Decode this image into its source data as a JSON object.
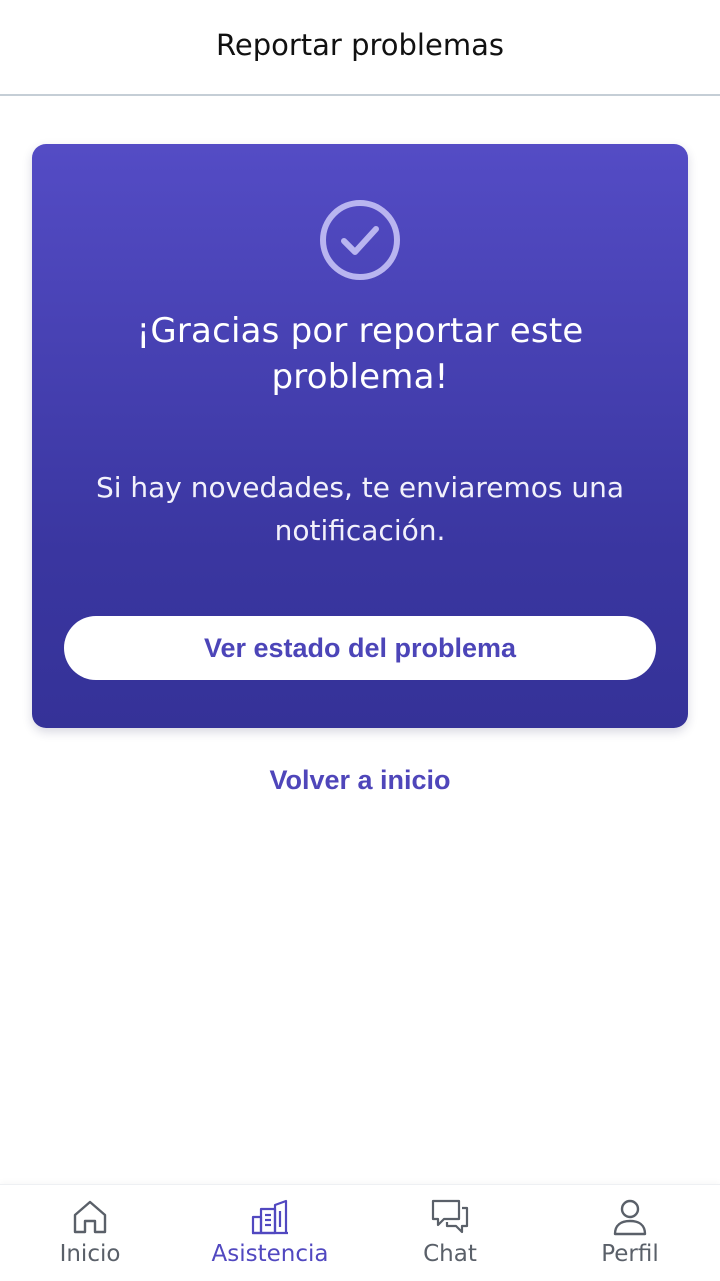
{
  "header": {
    "title": "Reportar problemas"
  },
  "card": {
    "icon": "check-circle-icon",
    "title": "¡Gracias por reportar este problema!",
    "message": "Si hay novedades, te enviaremos una notificación.",
    "button_label": "Ver estado del problema"
  },
  "home_link": {
    "label": "Volver a inicio"
  },
  "bottom_nav": {
    "items": [
      {
        "label": "Inicio",
        "icon": "home-icon",
        "active": false
      },
      {
        "label": "Asistencia",
        "icon": "buildings-icon",
        "active": true
      },
      {
        "label": "Chat",
        "icon": "chat-bubbles-icon",
        "active": false
      },
      {
        "label": "Perfil",
        "icon": "user-icon",
        "active": false
      }
    ]
  },
  "colors": {
    "accent": "#5148c0",
    "card_gradient_top": "#544cc5",
    "card_gradient_bottom": "#353298",
    "inactive_nav": "#5a6069"
  }
}
